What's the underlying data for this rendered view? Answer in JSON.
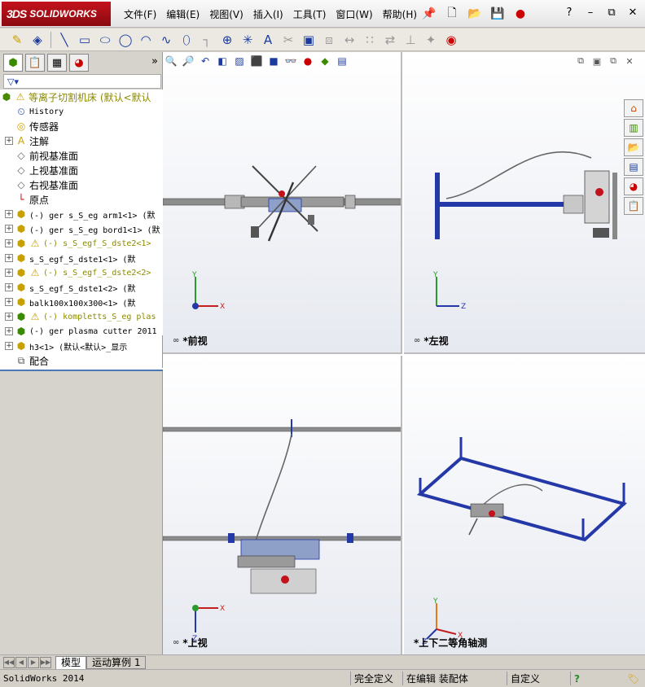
{
  "app": {
    "brand": "SOLIDWORKS",
    "brand_prefix": "3DS"
  },
  "menus": [
    {
      "label": "文件(F)"
    },
    {
      "label": "编辑(E)"
    },
    {
      "label": "视图(V)"
    },
    {
      "label": "插入(I)"
    },
    {
      "label": "工具(T)"
    },
    {
      "label": "窗口(W)"
    },
    {
      "label": "帮助(H)"
    }
  ],
  "feature_tree": {
    "root": "等离子切割机床  (默认<默认",
    "items": [
      {
        "label": "History",
        "icon": "history-icon",
        "exp": false,
        "warn": false,
        "mono": true
      },
      {
        "label": "传感器",
        "icon": "sensor-icon",
        "exp": false,
        "warn": false,
        "mono": false
      },
      {
        "label": "注解",
        "icon": "annotation-icon",
        "exp": true,
        "warn": false,
        "mono": false
      },
      {
        "label": "前视基准面",
        "icon": "plane-icon",
        "exp": false,
        "warn": false,
        "mono": false
      },
      {
        "label": "上视基准面",
        "icon": "plane-icon",
        "exp": false,
        "warn": false,
        "mono": false
      },
      {
        "label": "右视基准面",
        "icon": "plane-icon",
        "exp": false,
        "warn": false,
        "mono": false
      },
      {
        "label": "原点",
        "icon": "origin-icon",
        "exp": false,
        "warn": false,
        "mono": false
      },
      {
        "label": "(-) ger s_S_eg arm1<1> (默",
        "icon": "part-icon",
        "exp": true,
        "warn": false,
        "mono": true
      },
      {
        "label": "(-) ger s_S_eg bord1<1> (默",
        "icon": "part-icon",
        "exp": true,
        "warn": false,
        "mono": true
      },
      {
        "label": "(-) s_S_egf_S_dste2<1>",
        "icon": "part-icon",
        "exp": true,
        "warn": true,
        "mono": true,
        "olive": true
      },
      {
        "label": "s_S_egf_S_dste1<1> (默",
        "icon": "part-icon",
        "exp": true,
        "warn": false,
        "mono": true
      },
      {
        "label": "(-) s_S_egf_S_dste2<2>",
        "icon": "part-icon",
        "exp": true,
        "warn": true,
        "mono": true,
        "olive": true
      },
      {
        "label": "s_S_egf_S_dste1<2> (默",
        "icon": "part-icon",
        "exp": true,
        "warn": false,
        "mono": true
      },
      {
        "label": "balk100x100x300<1> (默",
        "icon": "part-icon",
        "exp": true,
        "warn": false,
        "mono": true
      },
      {
        "label": "(-) kompletts_S_eg plas",
        "icon": "assembly-icon",
        "exp": true,
        "warn": true,
        "mono": true,
        "olive": true
      },
      {
        "label": "(-) ger plasma cutter 2011",
        "icon": "assembly-icon",
        "exp": true,
        "warn": false,
        "mono": true
      },
      {
        "label": "h3<1> (默认<默认>_显示",
        "icon": "part-icon",
        "exp": true,
        "warn": false,
        "mono": true
      },
      {
        "label": "配合",
        "icon": "mate-icon",
        "exp": false,
        "warn": false,
        "mono": false
      }
    ]
  },
  "viewports": {
    "front": {
      "label": "*前视",
      "axes": [
        "Y",
        "X"
      ]
    },
    "left": {
      "label": "*左视",
      "axes": [
        "Y",
        "Z"
      ]
    },
    "top": {
      "label": "*上视",
      "axes": [
        "X",
        "Z"
      ]
    },
    "iso": {
      "label": "*上下二等角轴测",
      "axes": [
        "Y",
        "X",
        "Z"
      ]
    }
  },
  "model_tabs": [
    {
      "label": "模型",
      "active": true
    },
    {
      "label": "运动算例 1",
      "active": false
    }
  ],
  "status": {
    "app": "SolidWorks 2014",
    "definition": "完全定义",
    "mode": "在编辑 装配体",
    "units": "自定义",
    "help": "?"
  },
  "colors": {
    "frame": "#2438a8",
    "rail": "#8c8c8c",
    "accent": "#c4121c"
  }
}
